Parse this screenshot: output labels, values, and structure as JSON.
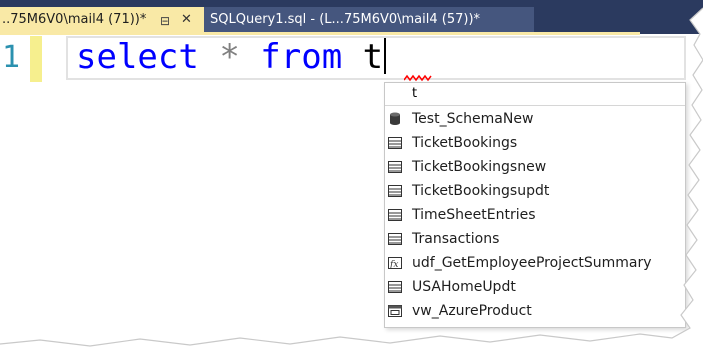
{
  "tabs": [
    {
      "label": "..75M6V0\\mail4 (71))*",
      "pin_icon": "pin-icon",
      "close_icon": "close-icon",
      "active": true
    },
    {
      "label": "SQLQuery1.sql - (L...75M6V0\\mail4 (57))*",
      "active": false
    }
  ],
  "editor": {
    "line_number": "1",
    "code": {
      "kw1": "select",
      "star": "*",
      "kw2": "from",
      "text": "t"
    }
  },
  "autocomplete": {
    "typed": "t",
    "items": [
      {
        "label": "Test_SchemaNew",
        "icon": "database-icon"
      },
      {
        "label": "TicketBookings",
        "icon": "table-icon"
      },
      {
        "label": "TicketBookingsnew",
        "icon": "table-icon"
      },
      {
        "label": "TicketBookingsupdt",
        "icon": "table-icon"
      },
      {
        "label": "TimeSheetEntries",
        "icon": "table-icon"
      },
      {
        "label": "Transactions",
        "icon": "table-icon"
      },
      {
        "label": "udf_GetEmployeeProjectSummary",
        "icon": "function-icon"
      },
      {
        "label": "USAHomeUpdt",
        "icon": "table-icon"
      },
      {
        "label": "vw_AzureProduct",
        "icon": "view-icon"
      }
    ]
  },
  "colors": {
    "tabbar": "#2b3a5f",
    "active_tab": "#f9e9a6",
    "keyword": "#0000ff",
    "line_number": "#2b91af",
    "squiggle": "#ff0000"
  }
}
